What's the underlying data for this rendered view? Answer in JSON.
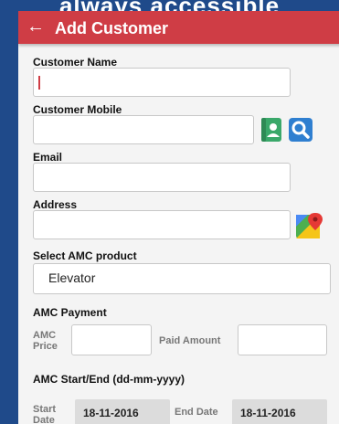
{
  "banner": {
    "text": "always accessible"
  },
  "appbar": {
    "back_glyph": "←",
    "title": "Add Customer"
  },
  "form": {
    "customer_name": {
      "label": "Customer Name",
      "value": ""
    },
    "customer_mobile": {
      "label": "Customer Mobile",
      "value": ""
    },
    "email": {
      "label": "Email",
      "value": ""
    },
    "address": {
      "label": "Address",
      "value": ""
    },
    "amc_product": {
      "label": "Select AMC product",
      "selected": "Elevator"
    },
    "amc_payment": {
      "label": "AMC Payment",
      "price_label_line1": "AMC",
      "price_label_line2": "Price",
      "paid_label": "Paid Amount",
      "price_value": "",
      "paid_value": ""
    },
    "amc_dates": {
      "label": "AMC Start/End (dd-mm-yyyy)",
      "start_label_line1": "Start",
      "start_label_line2": "Date",
      "start_value": "18-11-2016",
      "end_label": "End Date",
      "end_value": "18-11-2016"
    }
  },
  "icons": {
    "contacts": "contacts-book-icon",
    "search": "search-icon",
    "map": "google-maps-icon"
  },
  "colors": {
    "appbar": "#cf3d45",
    "background": "#1f4a8a",
    "contacts_icon": "#3aa86a",
    "search_icon": "#2f7fd0"
  }
}
